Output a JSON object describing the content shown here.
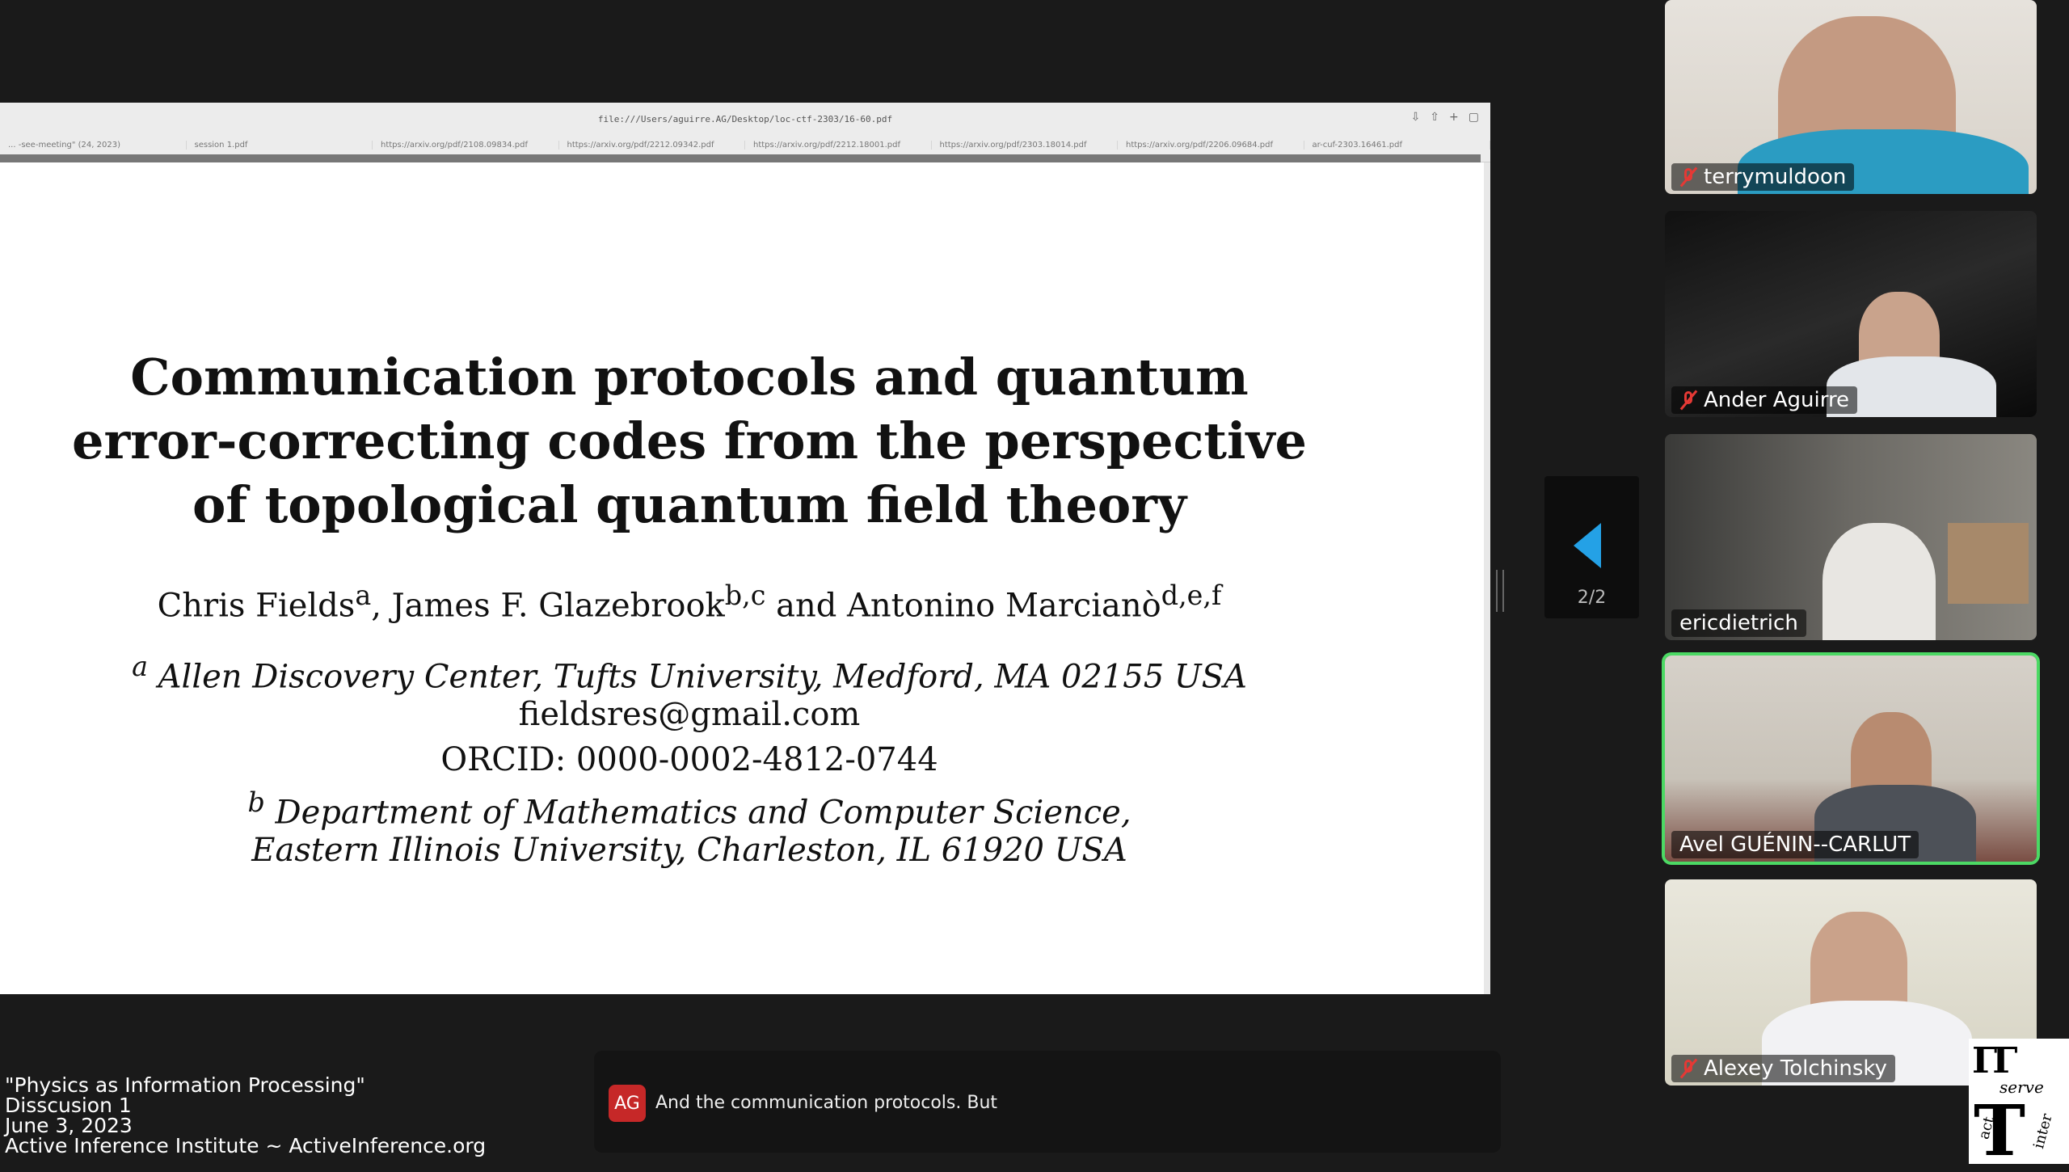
{
  "browser": {
    "url": "file:///Users/aguirre.AG/Desktop/loc-ctf-2303/16-60.pdf",
    "tabs": [
      "... -see-meeting\" (24, 2023)",
      "session 1.pdf",
      "https://arxiv.org/pdf/2108.09834.pdf",
      "https://arxiv.org/pdf/2212.09342.pdf",
      "https://arxiv.org/pdf/2212.18001.pdf",
      "https://arxiv.org/pdf/2303.18014.pdf",
      "https://arxiv.org/pdf/2206.09684.pdf",
      "ar-cuf-2303.16461.pdf"
    ]
  },
  "pdf": {
    "title_lines": [
      "Communication protocols and quantum",
      "error-correcting codes from the perspective",
      "of topological quantum field theory"
    ],
    "authors": {
      "a1": "Chris Fields",
      "a1_sup": "a",
      "a2": ", James F. Glazebrook",
      "a2_sup": "b,c",
      "a3": " and Antonino Marcianò",
      "a3_sup": "d,e,f"
    },
    "affil_a": {
      "sup": "a",
      "text": "Allen Discovery Center, Tufts University, Medford, MA 02155 USA"
    },
    "email": "fieldsres@gmail.com",
    "orcid": "ORCID: 0000-0002-4812-0744",
    "affil_b": {
      "sup": "b",
      "text": "Department of Mathematics and Computer Science,"
    },
    "affil_b2": "Eastern Illinois University, Charleston, IL 61920 USA"
  },
  "nav": {
    "page_count": "2/2",
    "arrow_icon": "chevron-left-icon"
  },
  "participants": [
    {
      "name": "terrymuldoon",
      "muted": true,
      "active": false
    },
    {
      "name": "Ander Aguirre",
      "muted": true,
      "active": false
    },
    {
      "name": "ericdietrich",
      "muted": false,
      "active": false
    },
    {
      "name": "Avel GUÉNIN--CARLUT",
      "muted": false,
      "active": true
    },
    {
      "name": "Alexey Tolchinsky",
      "muted": true,
      "active": false
    }
  ],
  "caption": {
    "initials": "AG",
    "text": "And the communication protocols. But"
  },
  "stream_info": {
    "line1": "\"Physics as Information Processing\"",
    "line2": "Disscusion 1",
    "line3": "June 3, 2023",
    "line4": "Active Inference Institute ~ ActiveInference.org"
  },
  "logo": {
    "top": "ΓΓ",
    "serve": "serve",
    "act": "act",
    "inter": "inter"
  },
  "colors": {
    "active_speaker": "#4cd964",
    "accent": "#24a1e6",
    "mute": "#e53935",
    "caption_avatar": "#c62828"
  }
}
